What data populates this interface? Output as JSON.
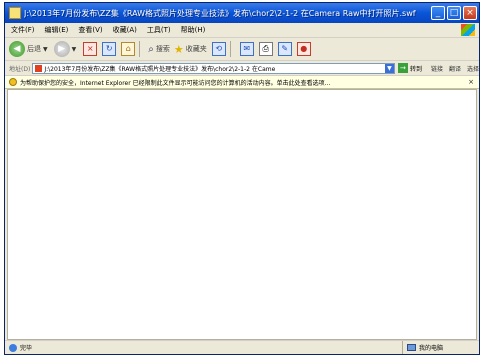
{
  "window": {
    "title": "J:\\2013年7月份发布\\ZZ集《RAW格式照片处理专业技法》发布\\chor2\\2-1-2 在Camera Raw中打开照片.swf",
    "min_glyph": "_",
    "max_glyph": "□",
    "close_glyph": "×"
  },
  "menu": [
    "文件(F)",
    "编辑(E)",
    "查看(V)",
    "收藏(A)",
    "工具(T)",
    "帮助(H)"
  ],
  "toolbar": {
    "back_label": "后退",
    "search_label": "搜索",
    "favorites_label": "收藏夹"
  },
  "address": {
    "label": "地址(D)",
    "value": "J:\\2013年7月份发布\\ZZ集《RAW格式照片处理专业技法》发布\\chor2\\2-1-2 在Came",
    "go_label": "转到",
    "links": [
      "链接",
      "翻译",
      "选择"
    ]
  },
  "infobar": {
    "text": "为帮助保护您的安全，Internet Explorer 已经限制此文件显示可能访问您的计算机的活动内容。单击此处查看选项..."
  },
  "status": {
    "left": "完毕",
    "right": "我的电脑"
  }
}
